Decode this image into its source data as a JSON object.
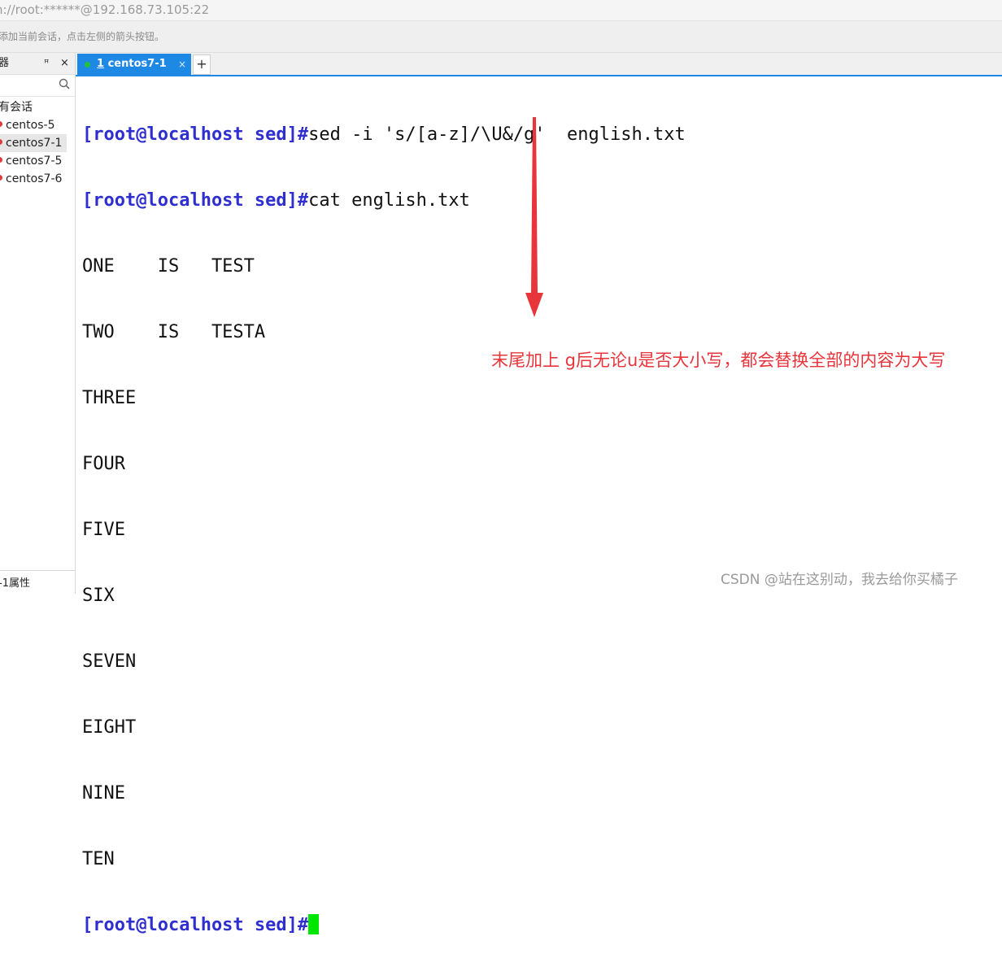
{
  "window": {
    "address": "h://root:******@192.168.73.105:22",
    "hint": "添加当前会话，点击左侧的箭头按钮。"
  },
  "sidebar": {
    "title": "器",
    "pin_glyph": "ꟸ",
    "close_glyph": "×",
    "root_label": "有会话",
    "items": [
      {
        "label": "centos-5",
        "selected": false
      },
      {
        "label": "centos7-1",
        "selected": true
      },
      {
        "label": "centos7-5",
        "selected": false
      },
      {
        "label": "centos7-6",
        "selected": false
      }
    ],
    "footer": "-1属性"
  },
  "tabs": {
    "active": {
      "index": "1",
      "name": "centos7-1"
    },
    "close_glyph": "×",
    "new_tab_glyph": "+"
  },
  "terminal": {
    "prompt": "[root@localhost sed]#",
    "command1": "sed -i 's/[a-z]/\\U&/g'  english.txt",
    "command2": "cat english.txt",
    "output": [
      "ONE    IS   TEST",
      "TWO    IS   TESTA",
      "THREE",
      "FOUR",
      "FIVE",
      "SIX",
      "SEVEN",
      "EIGHT",
      "NINE",
      "TEN"
    ]
  },
  "annotation": {
    "text": "末尾加上 g后无论u是否大小写，都会替换全部的内容为大写",
    "color": "#e8353b"
  },
  "watermark": "CSDN @站在这别动，我去给你买橘子",
  "colors": {
    "accent": "#1e88e5",
    "prompt": "#2f2fd0",
    "cursor": "#00e600",
    "session_dot": "#e23a3a",
    "connected_dot": "#22c33a"
  }
}
